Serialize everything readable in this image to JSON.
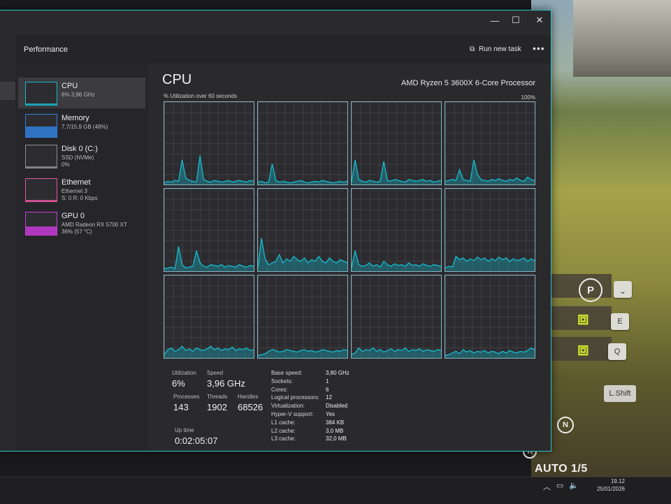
{
  "window": {
    "header_title": "Performance",
    "run_new_task": "Run new task",
    "more": "•••",
    "minimize": "—",
    "maximize": "☐",
    "close": "✕"
  },
  "sidebar": {
    "items": [
      {
        "name": "CPU",
        "sub1": "6% 3,96 GHz",
        "sub2": "",
        "sub3": "",
        "color": "#17b6c8",
        "fill": 0.06
      },
      {
        "name": "Memory",
        "sub1": "7,7/15,9 GB (48%)",
        "sub2": "",
        "sub3": "",
        "color": "#2f7fd9",
        "fill": 0.48
      },
      {
        "name": "Disk 0 (C:)",
        "sub1": "SSD (NVMe)",
        "sub2": "0%",
        "sub3": "",
        "color": "#8e8e8e",
        "fill": 0.0
      },
      {
        "name": "Ethernet",
        "sub1": "Ethernet 3",
        "sub2": "S: 0 R: 0 Kbps",
        "sub3": "",
        "color": "#e0569a",
        "fill": 0.05
      },
      {
        "name": "GPU 0",
        "sub1": "AMD Radeon RX 5700 XT",
        "sub2": "36% (57 °C)",
        "sub3": "",
        "color": "#c63bd6",
        "fill": 0.36
      }
    ]
  },
  "cpu": {
    "title": "CPU",
    "model": "AMD Ryzen 5 3600X 6-Core Processor",
    "util_label": "% Utilization over 60 seconds",
    "pct_label": "100%",
    "line_color": "#17b6c8"
  },
  "cores": [
    [
      2,
      4,
      3,
      5,
      4,
      30,
      8,
      5,
      4,
      3,
      35,
      6,
      4,
      3,
      5,
      4,
      3,
      4,
      5,
      3,
      4,
      5,
      4,
      3,
      5,
      4
    ],
    [
      3,
      4,
      2,
      3,
      25,
      5,
      3,
      4,
      3,
      2,
      3,
      4,
      5,
      3,
      2,
      3,
      4,
      3,
      5,
      4,
      3,
      2,
      3,
      4,
      3,
      4
    ],
    [
      3,
      30,
      6,
      4,
      3,
      5,
      4,
      3,
      4,
      28,
      5,
      4,
      6,
      5,
      4,
      3,
      6,
      5,
      4,
      5,
      6,
      4,
      5,
      3,
      4,
      5
    ],
    [
      4,
      5,
      6,
      5,
      18,
      6,
      5,
      4,
      30,
      12,
      6,
      5,
      4,
      6,
      5,
      7,
      5,
      4,
      6,
      5,
      8,
      5,
      4,
      9,
      6,
      5
    ],
    [
      3,
      4,
      5,
      3,
      30,
      8,
      4,
      5,
      6,
      25,
      10,
      6,
      5,
      8,
      7,
      6,
      8,
      5,
      7,
      6,
      5,
      8,
      6,
      5,
      7,
      6
    ],
    [
      4,
      40,
      15,
      8,
      10,
      12,
      20,
      10,
      15,
      12,
      18,
      14,
      12,
      16,
      10,
      14,
      12,
      18,
      12,
      10,
      16,
      12,
      10,
      14,
      12,
      10
    ],
    [
      4,
      25,
      8,
      6,
      7,
      10,
      6,
      8,
      5,
      12,
      8,
      6,
      9,
      7,
      8,
      6,
      10,
      7,
      8,
      6,
      9,
      7,
      6,
      8,
      7,
      6
    ],
    [
      4,
      6,
      5,
      18,
      14,
      16,
      12,
      15,
      13,
      17,
      14,
      16,
      12,
      15,
      13,
      17,
      14,
      16,
      12,
      15,
      13,
      14,
      16,
      12,
      15,
      13
    ],
    [
      4,
      10,
      12,
      8,
      10,
      14,
      9,
      11,
      8,
      12,
      10,
      9,
      11,
      14,
      10,
      12,
      9,
      11,
      10,
      13,
      9,
      11,
      10,
      12,
      9,
      10
    ],
    [
      3,
      4,
      5,
      8,
      10,
      9,
      7,
      8,
      10,
      9,
      8,
      7,
      9,
      10,
      8,
      9,
      7,
      8,
      10,
      9,
      8,
      7,
      9,
      8,
      10,
      9
    ],
    [
      4,
      6,
      12,
      8,
      10,
      9,
      12,
      8,
      10,
      7,
      9,
      11,
      8,
      10,
      9,
      12,
      8,
      10,
      9,
      11,
      8,
      10,
      9,
      8,
      10,
      9
    ],
    [
      3,
      4,
      6,
      8,
      5,
      10,
      7,
      9,
      6,
      8,
      7,
      9,
      6,
      8,
      7,
      5,
      8,
      6,
      9,
      7,
      6,
      8,
      7,
      9,
      12,
      10
    ]
  ],
  "stats": {
    "utilization_label": "Utilization",
    "utilization": "6%",
    "speed_label": "Speed",
    "speed": "3,96 GHz",
    "processes_label": "Processes",
    "processes": "143",
    "threads_label": "Threads",
    "threads": "1902",
    "handles_label": "Handles",
    "handles": "68526",
    "uptime_label": "Up time",
    "uptime": "0:02:05:07",
    "kv": [
      {
        "k": "Base speed:",
        "v": "3,80 GHz"
      },
      {
        "k": "Sockets:",
        "v": "1"
      },
      {
        "k": "Cores:",
        "v": "6"
      },
      {
        "k": "Logical processors:",
        "v": "12"
      },
      {
        "k": "Virtualization:",
        "v": "Disabled"
      },
      {
        "k": "Hyper-V support:",
        "v": "Yes"
      },
      {
        "k": "L1 cache:",
        "v": "384 KB"
      },
      {
        "k": "L2 cache:",
        "v": "3,0 MB"
      },
      {
        "k": "L3 cache:",
        "v": "32,0 MB"
      }
    ]
  },
  "game": {
    "park_key": "⎵",
    "e_key": "E",
    "q_key": "Q",
    "lshift": "L.Shift",
    "auto": "AUTO 1/5",
    "p_icon": "P",
    "n_icon": "N",
    "h_icon": "H"
  },
  "taskbar": {
    "time": "19.12",
    "date": "25/01/2026"
  }
}
